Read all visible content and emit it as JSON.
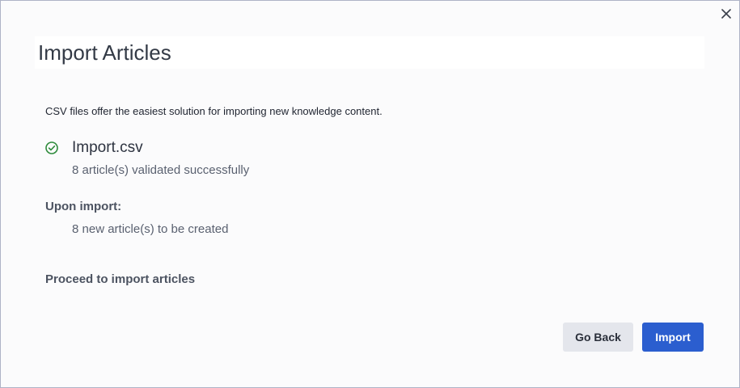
{
  "dialog": {
    "title": "Import Articles",
    "intro_text": "CSV files offer the easiest solution for importing new knowledge content.",
    "file": {
      "name": "Import.csv",
      "status": "8 article(s) validated successfully",
      "status_icon": "check-circle-icon",
      "status_color": "#2e8b3c"
    },
    "upon_import": {
      "heading": "Upon import:",
      "detail": "8 new article(s) to be created"
    },
    "proceed_text": "Proceed to import articles",
    "buttons": {
      "back_label": "Go Back",
      "import_label": "Import"
    },
    "colors": {
      "primary": "#2b5ecf",
      "secondary_button": "#e4e6ec"
    }
  }
}
